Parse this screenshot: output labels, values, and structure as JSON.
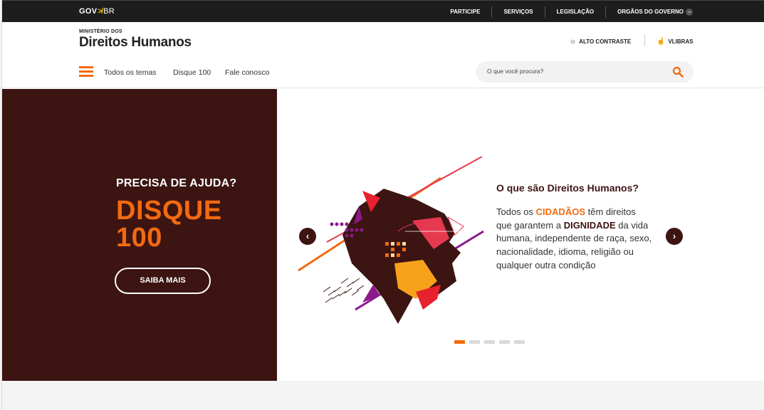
{
  "govbar": {
    "logo_gov": "GOV",
    "logo_arrow": "≯",
    "logo_br": "BR",
    "links": [
      "PARTICIPE",
      "SERVIÇOS",
      "LEGISLAÇÃO",
      "ORGÃOS DO GOVERNO"
    ]
  },
  "header": {
    "ministry_small": "MINISTÉRIO DOS",
    "ministry_name": "Direitos Humanos",
    "alto_contraste": "ALTO CONTRASTE",
    "vlibras": "VLIBRAS"
  },
  "nav": {
    "links": [
      "Todos os temas",
      "Disque 100",
      "Fale conosco"
    ],
    "search_placeholder": "O que você procura?"
  },
  "hero": {
    "question": "PRECISA DE AJUDA?",
    "big_line1": "DISQUE",
    "big_line2": "100",
    "button": "SAIBA MAIS"
  },
  "carousel": {
    "title": "O que são Direitos Humanos?",
    "text_1": "Todos os ",
    "highlight_1": "CIDADÃOS",
    "text_2": " têm direitos  que garantem a ",
    "highlight_2": "DIGNIDADE",
    "text_3": " da vida humana, independente de raça, sexo, nacionalidade, idioma, religião ou qualquer outra condição",
    "prev": "‹",
    "next": "›",
    "slides": 5,
    "active_slide": 1
  },
  "colors": {
    "accent": "#f26a0f",
    "brown": "#3c1412",
    "govbar": "#1d1d1d"
  }
}
